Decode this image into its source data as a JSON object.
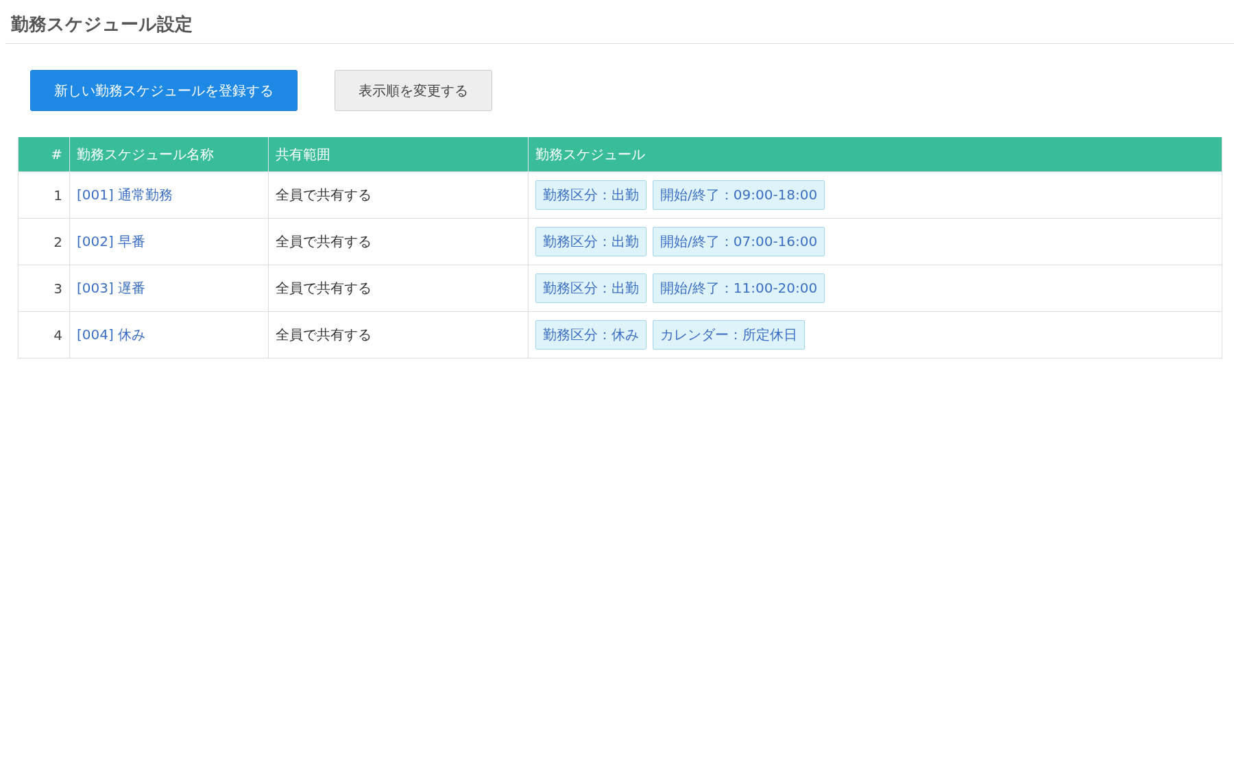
{
  "page_title": "勤務スケジュール設定",
  "buttons": [
    {
      "label": "新しい勤務スケジュールを登録する",
      "kind": "primary"
    },
    {
      "label": "表示順を変更する",
      "kind": "secondary"
    }
  ],
  "table": {
    "columns": [
      "#",
      "勤務スケジュール名称",
      "共有範囲",
      "勤務スケジュール"
    ],
    "rows": [
      {
        "number": "1",
        "name": "[001] 通常勤務",
        "scope": "全員で共有する",
        "tags": [
          "勤務区分：出勤",
          "開始/終了：09:00-18:00"
        ]
      },
      {
        "number": "2",
        "name": "[002] 早番",
        "scope": "全員で共有する",
        "tags": [
          "勤務区分：出勤",
          "開始/終了：07:00-16:00"
        ]
      },
      {
        "number": "3",
        "name": "[003] 遅番",
        "scope": "全員で共有する",
        "tags": [
          "勤務区分：出勤",
          "開始/終了：11:00-20:00"
        ]
      },
      {
        "number": "4",
        "name": "[004] 休み",
        "scope": "全員で共有する",
        "tags": [
          "勤務区分：休み",
          "カレンダー：所定休日"
        ]
      }
    ]
  }
}
